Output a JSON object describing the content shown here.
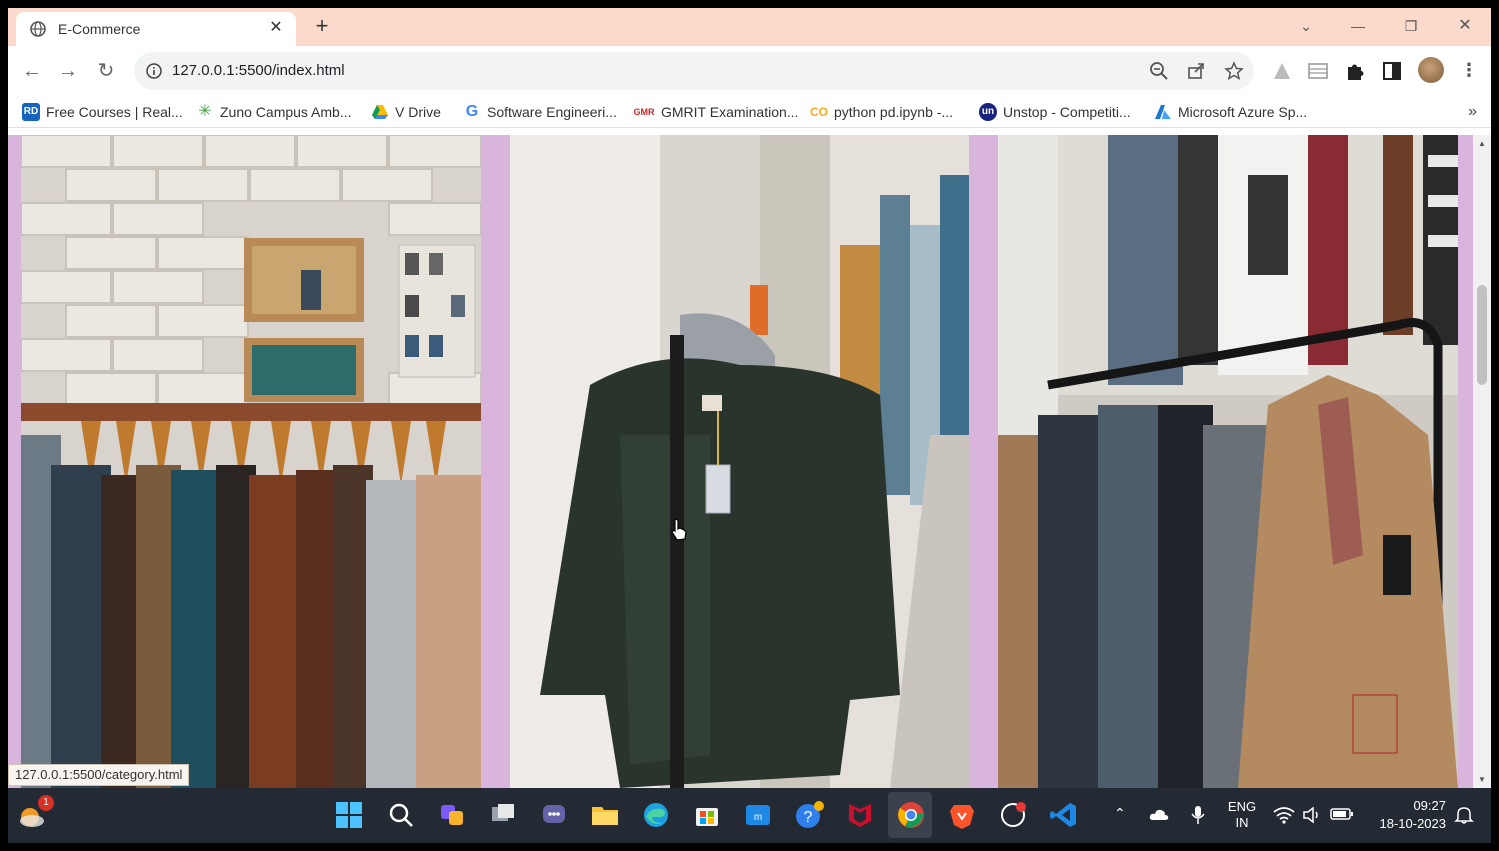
{
  "window": {
    "tab_title": "E-Commerce",
    "tab_close_icon": "close-icon",
    "new_tab_label": "+"
  },
  "toolbar": {
    "url": "127.0.0.1:5500/index.html"
  },
  "bookmarks": {
    "items": [
      {
        "label": "Free Courses | Real...",
        "icon": "RD",
        "color": "#1565c0"
      },
      {
        "label": "Zuno Campus Amb...",
        "icon": "zuno",
        "color": "#43a047"
      },
      {
        "label": "V Drive",
        "icon": "drive",
        "color": "#fbbc04"
      },
      {
        "label": "Software Engineeri...",
        "icon": "G",
        "color": "#4285f4"
      },
      {
        "label": "GMRIT Examination...",
        "icon": "GMR",
        "color": "#c62828"
      },
      {
        "label": "python pd.ipynb -...",
        "icon": "CO",
        "color": "#f9a825"
      },
      {
        "label": "Unstop - Competiti...",
        "icon": "un",
        "color": "#1a237e"
      },
      {
        "label": "Microsoft Azure Sp...",
        "icon": "azure",
        "color": "#1976d2"
      }
    ],
    "more_label": "»"
  },
  "page": {
    "background_color": "#d9b5dd",
    "photos": [
      {
        "subject": "clothes-rack-brick-wall"
      },
      {
        "subject": "sweater-on-hanger-street"
      },
      {
        "subject": "jackets-on-rack"
      }
    ]
  },
  "status": {
    "hover_url": "127.0.0.1:5500/category.html"
  },
  "taskbar": {
    "weather_badge": "1",
    "language_line1": "ENG",
    "language_line2": "IN",
    "time": "09:27",
    "date": "18-10-2023"
  }
}
